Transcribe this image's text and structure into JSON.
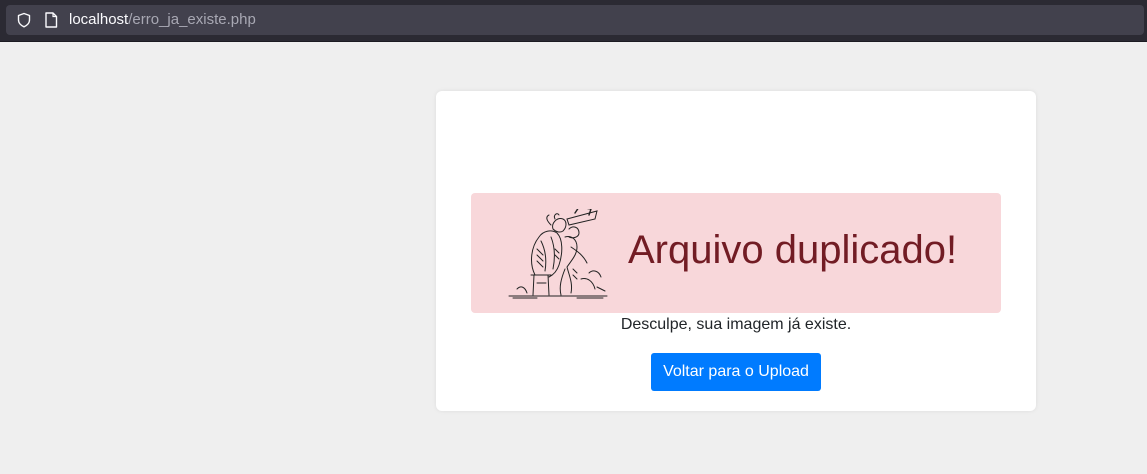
{
  "browser": {
    "url_host": "localhost",
    "url_path": "/erro_ja_existe.php",
    "icons": [
      "shield-icon",
      "page-icon"
    ]
  },
  "card": {
    "illustration": "sketch-illustration",
    "title": "Arquivo duplicado!",
    "message": "Desculpe, sua imagem já existe.",
    "button_label": "Voltar para o Upload"
  },
  "colors": {
    "page_bg": "#efefef",
    "alert_bg": "#f8d7da",
    "alert_text": "#721c24",
    "button_bg": "#007bff",
    "button_text": "#ffffff"
  }
}
